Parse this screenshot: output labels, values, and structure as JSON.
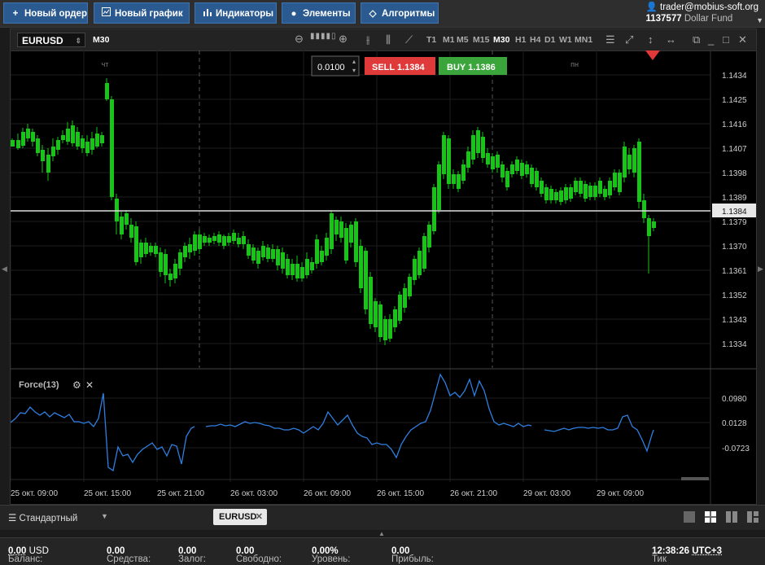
{
  "toolbar": {
    "new_order": "Новый ордер",
    "new_chart": "Новый график",
    "indicators": "Индикаторы",
    "elements": "Элементы",
    "algorithms": "Алгоритмы"
  },
  "account": {
    "user": "trader@mobius-soft.org",
    "id": "1137577",
    "fund": "Dollar Fund"
  },
  "chart_window": {
    "symbol": "EURUSD",
    "timeframe": "M30",
    "timeframes": [
      "T1",
      "M1",
      "M5",
      "M15",
      "M30",
      "H1",
      "H4",
      "D1",
      "W1",
      "MN1"
    ],
    "active_timeframe": "M30",
    "lot": "0.0100",
    "sell_label": "SELL",
    "sell_price": "1.1384",
    "buy_label": "BUY",
    "buy_price": "1.1386",
    "day_labels": [
      "чт",
      "пн"
    ],
    "current_price": "1.1384",
    "price_ticks": [
      "1.1434",
      "1.1425",
      "1.1416",
      "1.1407",
      "1.1398",
      "1.1389",
      "1.1379",
      "1.1370",
      "1.1361",
      "1.1352",
      "1.1343",
      "1.1334"
    ],
    "indicator_name": "Force(13)",
    "indicator_ticks": [
      "0.0980",
      "0.0128",
      "-0.0723"
    ],
    "time_ticks": [
      "25 окт. 09:00",
      "25 окт. 15:00",
      "25 окт. 21:00",
      "26 окт. 03:00",
      "26 окт. 09:00",
      "26 окт. 15:00",
      "26 окт. 21:00",
      "29 окт. 03:00",
      "29 окт. 09:00"
    ]
  },
  "footer": {
    "layout_name": "Стандартный",
    "tab_symbol": "EURUSD"
  },
  "status": {
    "balance_label": "Баланс:",
    "balance": "0.00",
    "balance_ccy": "USD",
    "funds_label": "Средства:",
    "funds": "0.00",
    "margin_label": "Залог:",
    "margin": "0.00",
    "free_label": "Свободно:",
    "free": "0.00",
    "level_label": "Уровень:",
    "level": "0.00%",
    "profit_label": "Прибыль:",
    "profit": "0.00",
    "tick_label": "Тик",
    "tick_time": "12:38:26",
    "tz": "UTC+3"
  },
  "colors": {
    "bull": "#19c419",
    "accent_blue": "#2a5a8f",
    "sell": "#e0393a",
    "buy": "#3aa53a",
    "force_line": "#2f7fe0"
  }
}
